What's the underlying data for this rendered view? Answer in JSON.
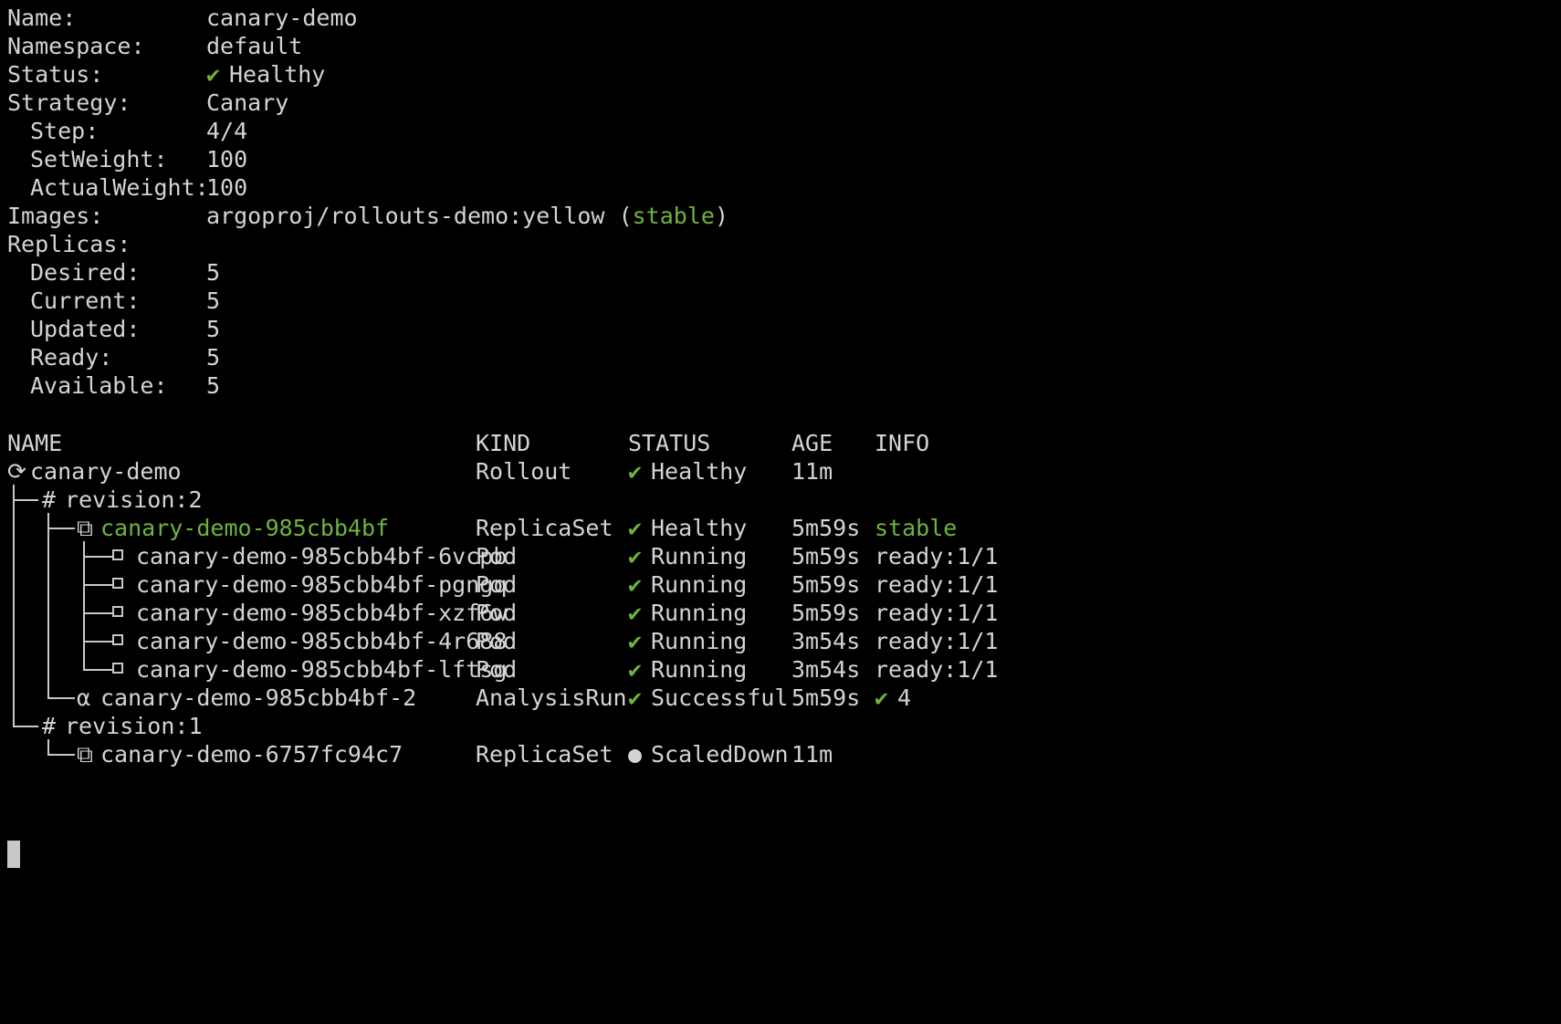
{
  "details": {
    "name_label": "Name:",
    "name_value": "canary-demo",
    "namespace_label": "Namespace:",
    "namespace_value": "default",
    "status_label": "Status:",
    "status_icon": "✔",
    "status_value": "Healthy",
    "strategy_label": "Strategy:",
    "strategy_value": "Canary",
    "step_label": "Step:",
    "step_value": "4/4",
    "setweight_label": "SetWeight:",
    "setweight_value": "100",
    "actualweight_label": "ActualWeight:",
    "actualweight_value": "100",
    "images_label": "Images:",
    "images_value": "argoproj/rollouts-demo:yellow",
    "images_open": "(",
    "images_tag": "stable",
    "images_close": ")",
    "replicas_label": "Replicas:",
    "desired_label": "Desired:",
    "desired_value": "5",
    "current_label": "Current:",
    "current_value": "5",
    "updated_label": "Updated:",
    "updated_value": "5",
    "ready_label": "Ready:",
    "ready_value": "5",
    "available_label": "Available:",
    "available_value": "5"
  },
  "table": {
    "headers": [
      "NAME",
      "KIND",
      "STATUS",
      "AGE",
      "INFO"
    ],
    "rows": [
      {
        "icon": "⟳",
        "name": "canary-demo",
        "kind": "Rollout",
        "status_icon": "✔",
        "status": "Healthy",
        "age": "11m",
        "info": ""
      },
      {
        "icon": "#",
        "name": "revision:2",
        "kind": "",
        "status_icon": "",
        "status": "",
        "age": "",
        "info": ""
      },
      {
        "icon": "⧉",
        "name": "canary-demo-985cbb4bf",
        "kind": "ReplicaSet",
        "status_icon": "✔",
        "status": "Healthy",
        "age": "5m59s",
        "info": "stable"
      },
      {
        "icon": "□",
        "name": "canary-demo-985cbb4bf-6vcpb",
        "kind": "Pod",
        "status_icon": "✔",
        "status": "Running",
        "age": "5m59s",
        "info": "ready:1/1"
      },
      {
        "icon": "□",
        "name": "canary-demo-985cbb4bf-pgngq",
        "kind": "Pod",
        "status_icon": "✔",
        "status": "Running",
        "age": "5m59s",
        "info": "ready:1/1"
      },
      {
        "icon": "□",
        "name": "canary-demo-985cbb4bf-xzf6w",
        "kind": "Pod",
        "status_icon": "✔",
        "status": "Running",
        "age": "5m59s",
        "info": "ready:1/1"
      },
      {
        "icon": "□",
        "name": "canary-demo-985cbb4bf-4r688",
        "kind": "Pod",
        "status_icon": "✔",
        "status": "Running",
        "age": "3m54s",
        "info": "ready:1/1"
      },
      {
        "icon": "□",
        "name": "canary-demo-985cbb4bf-lftsg",
        "kind": "Pod",
        "status_icon": "✔",
        "status": "Running",
        "age": "3m54s",
        "info": "ready:1/1"
      },
      {
        "icon": "α",
        "name": "canary-demo-985cbb4bf-2",
        "kind": "AnalysisRun",
        "status_icon": "✔",
        "status": "Successful",
        "age": "5m59s",
        "info_icon": "✔",
        "info": "4"
      },
      {
        "icon": "#",
        "name": "revision:1",
        "kind": "",
        "status_icon": "",
        "status": "",
        "age": "",
        "info": ""
      },
      {
        "icon": "⧉",
        "name": "canary-demo-6757fc94c7",
        "kind": "ReplicaSet",
        "status_icon": "●",
        "status": "ScaledDown",
        "age": "11m",
        "info": ""
      }
    ]
  },
  "colors": {
    "background": "#000000",
    "text": "#d4d4d4",
    "green": "#6fb33d"
  }
}
